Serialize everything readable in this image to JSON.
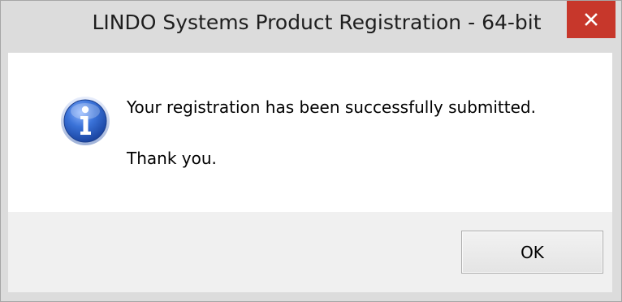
{
  "window": {
    "title": "LINDO Systems Product Registration - 64-bit",
    "close_icon": "close-x-icon"
  },
  "dialog": {
    "icon": "info-icon",
    "message": "Your registration has been successfully submitted.",
    "thanks": "Thank you.",
    "ok_label": "OK"
  },
  "colors": {
    "close_button": "#c7372b",
    "info_icon_blue": "#2a5fc4",
    "footer_bg": "#f0f0f0",
    "frame_bg": "#dcdcdc"
  }
}
